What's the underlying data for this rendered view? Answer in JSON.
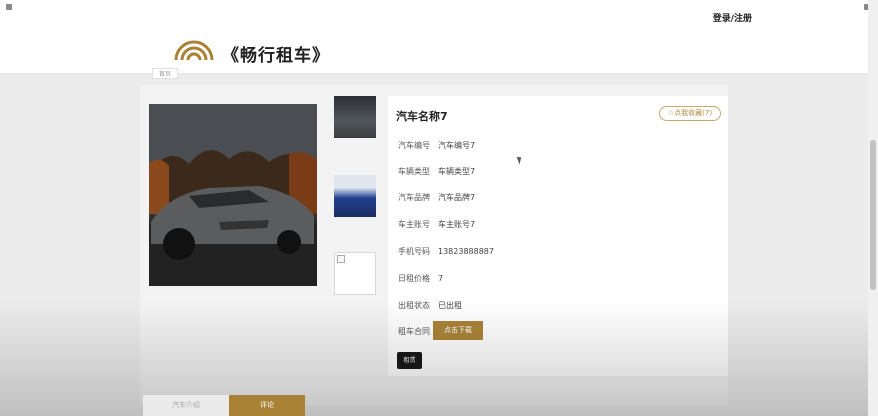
{
  "topbar": {
    "login_label": "登录/注册"
  },
  "header": {
    "brand": "《畅行租车》"
  },
  "breadcrumb": {
    "label": "首页"
  },
  "car": {
    "name": "汽车名称7",
    "favorite_label": "☆点我收藏(7)",
    "fields": [
      {
        "label": "汽车编号",
        "value": "汽车编号7"
      },
      {
        "label": "车辆类型",
        "value": "车辆类型7"
      },
      {
        "label": "汽车品牌",
        "value": "汽车品牌7"
      },
      {
        "label": "车主账号",
        "value": "车主账号7"
      },
      {
        "label": "手机号码",
        "value": "13823888887"
      },
      {
        "label": "日租价格",
        "value": "7"
      },
      {
        "label": "出租状态",
        "value": "已出租"
      },
      {
        "label": "租车合同",
        "value": ""
      }
    ],
    "download_label": "点击下载",
    "rent_label": "租赁"
  },
  "tabs": [
    {
      "label": "汽车介绍"
    },
    {
      "label": "评论"
    }
  ],
  "colors": {
    "accent": "#a98236",
    "favorite_border": "#c8a96a"
  }
}
